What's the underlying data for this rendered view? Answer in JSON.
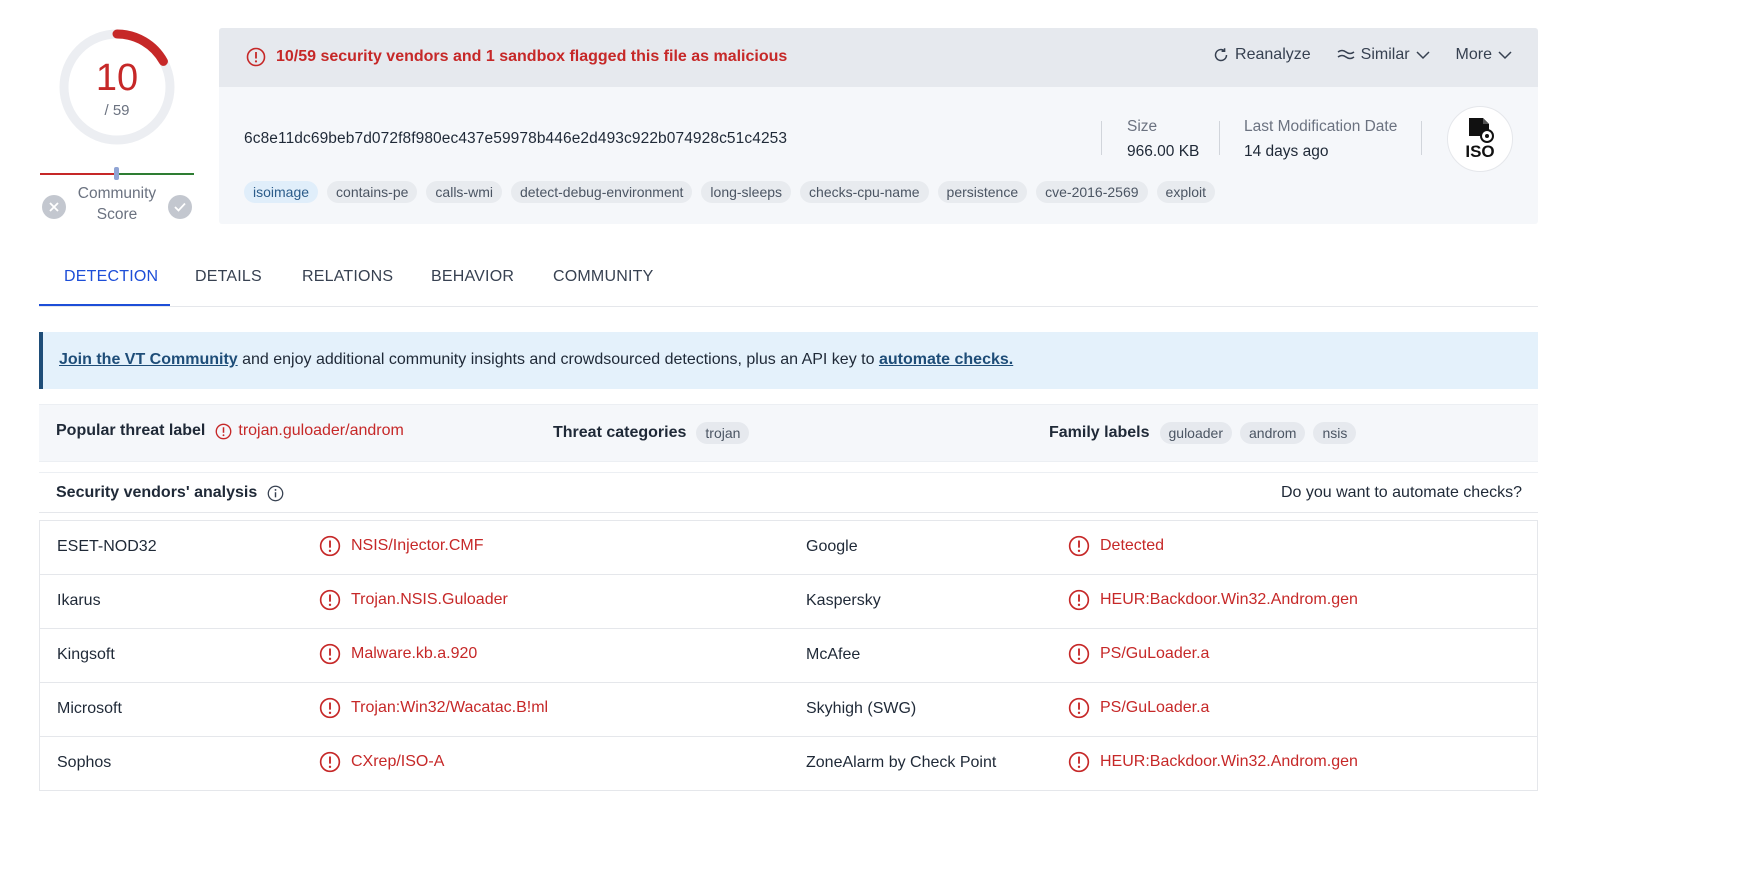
{
  "score": {
    "value": "10",
    "total": "/ 59",
    "detected": 10,
    "total_count": 59
  },
  "community": {
    "label": "Community Score"
  },
  "alert": {
    "text": "10/59 security vendors and 1 sandbox flagged this file as malicious"
  },
  "actions": {
    "reanalyze": "Reanalyze",
    "similar": "Similar",
    "more": "More"
  },
  "file": {
    "hash": "6c8e11dc69beb7d072f8f980ec437e59978b446e2d493c922b074928c51c4253",
    "size_label": "Size",
    "size_value": "966.00 KB",
    "date_label": "Last Modification Date",
    "date_value": "14 days ago",
    "type_icon_text": "ISO"
  },
  "tags": [
    "isoimage",
    "contains-pe",
    "calls-wmi",
    "detect-debug-environment",
    "long-sleeps",
    "checks-cpu-name",
    "persistence",
    "cve-2016-2569",
    "exploit"
  ],
  "tabs": [
    "DETECTION",
    "DETAILS",
    "RELATIONS",
    "BEHAVIOR",
    "COMMUNITY"
  ],
  "banner": {
    "link1": "Join the VT Community",
    "middle": " and enjoy additional community insights and crowdsourced detections, plus an API key to ",
    "link2": "automate checks."
  },
  "threat": {
    "popular_label": "Popular threat label",
    "popular_value": "trojan.guloader/androm",
    "categories_label": "Threat categories",
    "categories": [
      "trojan"
    ],
    "family_label": "Family labels",
    "families": [
      "guloader",
      "androm",
      "nsis"
    ]
  },
  "vendors": {
    "title": "Security vendors' analysis",
    "automate": "Do you want to automate checks?",
    "rows": [
      {
        "v1": "ESET-NOD32",
        "r1": "NSIS/Injector.CMF",
        "v2": "Google",
        "r2": "Detected"
      },
      {
        "v1": "Ikarus",
        "r1": "Trojan.NSIS.Guloader",
        "v2": "Kaspersky",
        "r2": "HEUR:Backdoor.Win32.Androm.gen"
      },
      {
        "v1": "Kingsoft",
        "r1": "Malware.kb.a.920",
        "v2": "McAfee",
        "r2": "PS/GuLoader.a"
      },
      {
        "v1": "Microsoft",
        "r1": "Trojan:Win32/Wacatac.B!ml",
        "v2": "Skyhigh (SWG)",
        "r2": "PS/GuLoader.a"
      },
      {
        "v1": "Sophos",
        "r1": "CXrep/ISO-A",
        "v2": "ZoneAlarm by Check Point",
        "r2": "HEUR:Backdoor.Win32.Androm.gen"
      }
    ]
  },
  "colors": {
    "malicious": "#c62828",
    "accent": "#1d4ed8",
    "banner_border": "#1e4d78"
  }
}
